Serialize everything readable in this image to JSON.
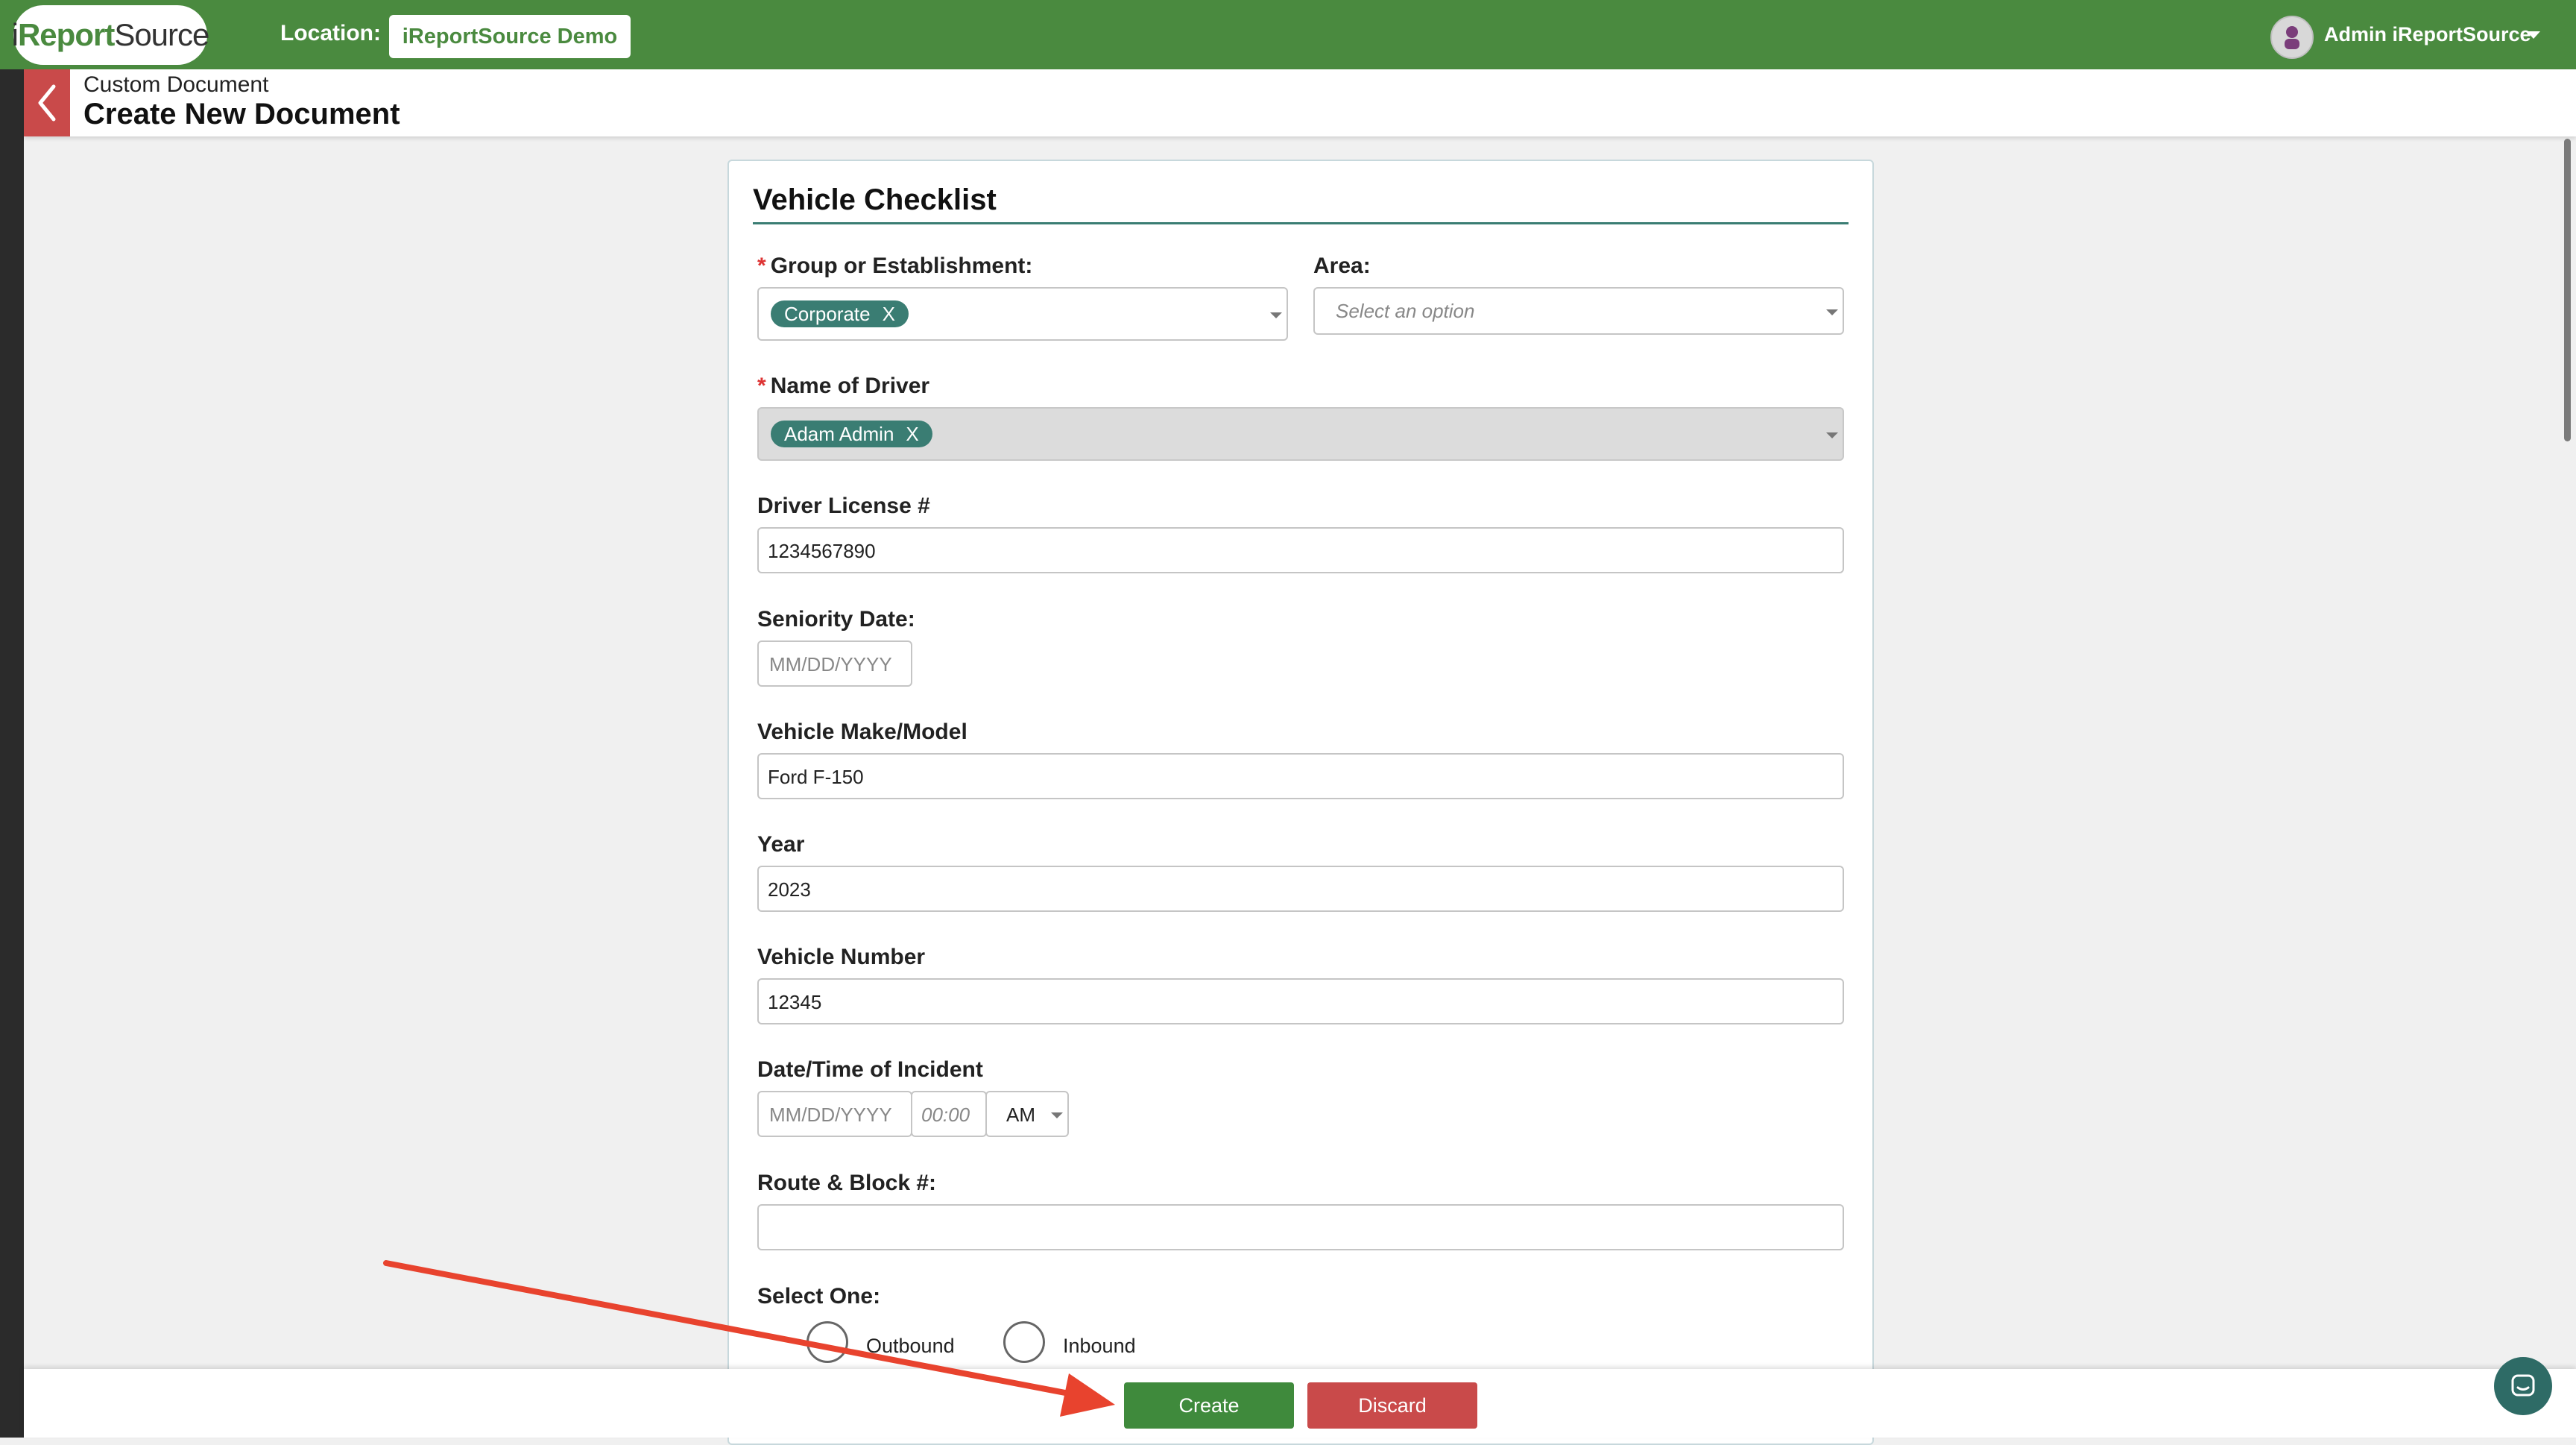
{
  "app": {
    "logo_prefix": "i",
    "logo_brand": "Report",
    "logo_suffix": "Source",
    "location_label": "Location:",
    "location_value": "iReportSource Demo",
    "user_name": "Admin iReportSource",
    "brand_color": "#4a8a3f"
  },
  "header": {
    "breadcrumb": "Custom Document",
    "title": "Create New Document",
    "back_icon": "chevron-left-icon"
  },
  "form": {
    "title": "Vehicle Checklist",
    "required_mark": "*",
    "group": {
      "label": "Group or Establishment:",
      "chip": "Corporate",
      "chip_remove": "X"
    },
    "area": {
      "label": "Area:",
      "placeholder": "Select an option"
    },
    "driver": {
      "label": "Name of Driver",
      "chip": "Adam Admin",
      "chip_remove": "X"
    },
    "license": {
      "label": "Driver License #",
      "value": "1234567890"
    },
    "seniority": {
      "label": "Seniority Date:",
      "placeholder": "MM/DD/YYYY"
    },
    "make_model": {
      "label": "Vehicle Make/Model",
      "value": "Ford F-150"
    },
    "year": {
      "label": "Year",
      "value": "2023"
    },
    "vehicle_number": {
      "label": "Vehicle Number",
      "value": "12345"
    },
    "incident": {
      "label": "Date/Time of Incident",
      "date_placeholder": "MM/DD/YYYY",
      "time_placeholder": "00:00",
      "ampm": "AM"
    },
    "route": {
      "label": "Route & Block #:",
      "value": ""
    },
    "select_one": {
      "label": "Select One:",
      "options": [
        "Outbound",
        "Inbound"
      ]
    }
  },
  "actions": {
    "create_label": "Create",
    "discard_label": "Discard",
    "create_color": "#3f8a3c",
    "discard_color": "#c94a4a"
  },
  "annotation": {
    "arrow_color": "#e8432e",
    "arrow_target": "create-button"
  }
}
